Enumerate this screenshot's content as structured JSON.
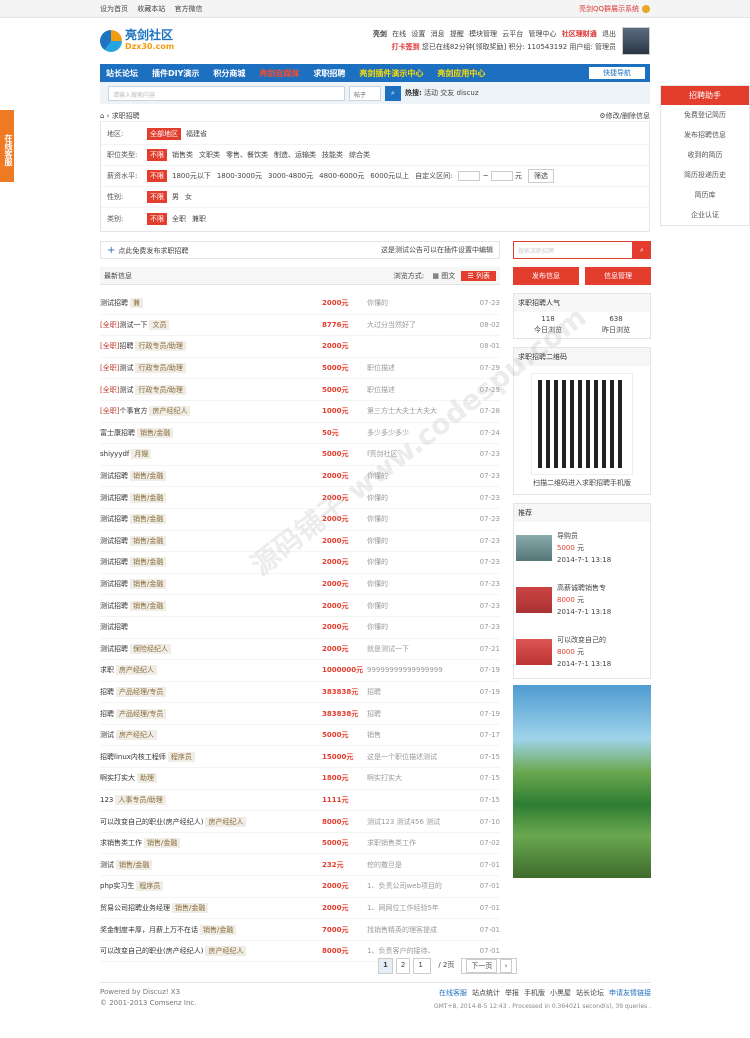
{
  "topbar": {
    "left": [
      "设为首页",
      "收藏本站",
      "官方微信"
    ],
    "right": "亮剑QQ群展示系统"
  },
  "logo": {
    "name": "亮剑社区",
    "domain": "Dzx30.com"
  },
  "user": {
    "name": "亮剑",
    "links": [
      "在线",
      "设置",
      "消息",
      "提醒",
      "模块管理",
      "云平台",
      "管理中心",
      "社区理财通",
      "退出"
    ],
    "line2": [
      "打卡签到",
      "您已在线82分钟[领取奖励]",
      "积分: 110543192",
      "用户组: 管理员"
    ]
  },
  "nav": {
    "items": [
      "站长论坛",
      "插件DIY演示",
      "积分商城",
      "亮剑自媒体",
      "求职招聘",
      "亮剑插件演示中心",
      "亮剑应用中心"
    ],
    "quick": "快捷导航"
  },
  "search": {
    "placeholder": "请输入搜索内容",
    "type": "帖子",
    "hot_label": "热搜:",
    "hot": [
      "活动",
      "交友",
      "discuz"
    ]
  },
  "breadcrumb": {
    "current": "求职招聘",
    "edit": "修改/删除信息"
  },
  "filters": {
    "area": {
      "label": "地区:",
      "selected": "全部地区",
      "options": [
        "福建省"
      ]
    },
    "job": {
      "label": "职位类型:",
      "selected": "不限",
      "options": [
        "销售类",
        "文职类",
        "零售、餐饮类",
        "制造、运输类",
        "技能类",
        "综合类"
      ]
    },
    "salary": {
      "label": "薪资水平:",
      "selected": "不限",
      "options": [
        "1800元以下",
        "1800-3000元",
        "3000-4800元",
        "4800-6000元",
        "6000元以上"
      ],
      "custom": "自定义区间:",
      "unit": "元",
      "btn": "筛选"
    },
    "gender": {
      "label": "性别:",
      "selected": "不限",
      "options": [
        "男",
        "女"
      ]
    },
    "kind": {
      "label": "类别:",
      "selected": "不限",
      "options": [
        "全职",
        "兼职"
      ]
    }
  },
  "post_bar": {
    "left": "点此免费发布求职招聘",
    "right": "这是测试公告可以在插件设置中编辑"
  },
  "list_head": {
    "title": "最新信息",
    "view": "浏览方式:",
    "pic": "图文",
    "list": "列表"
  },
  "rows": [
    {
      "pre": "",
      "title": "测试招聘",
      "cat": "兼",
      "salary": "2000元",
      "desc": "你懂的",
      "date": "07-23"
    },
    {
      "pre": "[全职]",
      "title": "测试一下",
      "cat": "文员",
      "salary": "8776元",
      "desc": "大过分当然好了",
      "date": "08-02"
    },
    {
      "pre": "[全职]",
      "title": "招聘",
      "cat": "行政专员/助理",
      "salary": "2000元",
      "desc": "",
      "date": "08-01"
    },
    {
      "pre": "[全职]",
      "title": "测试",
      "cat": "行政专员/助理",
      "salary": "5000元",
      "desc": "职位描述",
      "date": "07-29"
    },
    {
      "pre": "[全职]",
      "title": "测试",
      "cat": "行政专员/助理",
      "salary": "5000元",
      "desc": "职位描述",
      "date": "07-29"
    },
    {
      "pre": "[全职]",
      "title": "个事官方",
      "cat": "房产经纪人",
      "salary": "1000元",
      "desc": "第三方士大夫士大夫大",
      "date": "07-28"
    },
    {
      "pre": "",
      "title": "富士康招聘",
      "cat": "销售/金融",
      "salary": "50元",
      "desc": "多少多少多少",
      "date": "07-24"
    },
    {
      "pre": "",
      "title": "shiyyydf",
      "cat": "月嫂",
      "salary": "5000元",
      "desc": "f亮剑社区",
      "date": "07-23"
    },
    {
      "pre": "",
      "title": "测试招聘",
      "cat": "销售/金融",
      "salary": "2000元",
      "desc": "你懂的",
      "date": "07-23"
    },
    {
      "pre": "",
      "title": "测试招聘",
      "cat": "销售/金融",
      "salary": "2000元",
      "desc": "你懂的",
      "date": "07-23"
    },
    {
      "pre": "",
      "title": "测试招聘",
      "cat": "销售/金融",
      "salary": "2000元",
      "desc": "你懂的",
      "date": "07-23"
    },
    {
      "pre": "",
      "title": "测试招聘",
      "cat": "销售/金融",
      "salary": "2000元",
      "desc": "你懂的",
      "date": "07-23"
    },
    {
      "pre": "",
      "title": "测试招聘",
      "cat": "销售/金融",
      "salary": "2000元",
      "desc": "你懂的",
      "date": "07-23"
    },
    {
      "pre": "",
      "title": "测试招聘",
      "cat": "销售/金融",
      "salary": "2000元",
      "desc": "你懂的",
      "date": "07-23"
    },
    {
      "pre": "",
      "title": "测试招聘",
      "cat": "销售/金融",
      "salary": "2000元",
      "desc": "你懂的",
      "date": "07-23"
    },
    {
      "pre": "",
      "title": "测试招聘",
      "cat": "",
      "salary": "2000元",
      "desc": "你懂的",
      "date": "07-23"
    },
    {
      "pre": "",
      "title": "测试招聘",
      "cat": "保险经纪人",
      "salary": "2000元",
      "desc": "就是测试一下",
      "date": "07-21"
    },
    {
      "pre": "",
      "title": "求职",
      "cat": "房产经纪人",
      "salary": "1000000元",
      "desc": "99999999999999999",
      "date": "07-19"
    },
    {
      "pre": "",
      "title": "招聘",
      "cat": "产品经理/专员",
      "salary": "383838元",
      "desc": "招聘",
      "date": "07-19"
    },
    {
      "pre": "",
      "title": "招聘",
      "cat": "产品经理/专员",
      "salary": "383838元",
      "desc": "招聘",
      "date": "07-19"
    },
    {
      "pre": "",
      "title": "测试",
      "cat": "房产经纪人",
      "salary": "5000元",
      "desc": "销售",
      "date": "07-17"
    },
    {
      "pre": "",
      "title": "招聘linux内核工程师",
      "cat": "程序员",
      "salary": "15000元",
      "desc": "这是一个职位描述测试",
      "date": "07-15"
    },
    {
      "pre": "",
      "title": "啊实打实大",
      "cat": "助理",
      "salary": "1800元",
      "desc": "啊实打实大",
      "date": "07-15"
    },
    {
      "pre": "",
      "title": "123",
      "cat": "人事专员/助理",
      "salary": "1111元",
      "desc": "",
      "date": "07-15"
    },
    {
      "pre": "",
      "title": "可以改变自己的职业(房产经纪人)",
      "cat": "房产经纪人",
      "salary": "8000元",
      "desc": "测试123 测试456 测试",
      "date": "07-10"
    },
    {
      "pre": "",
      "title": "求销售类工作",
      "cat": "销售/金融",
      "salary": "5000元",
      "desc": "求职销售类工作",
      "date": "07-02"
    },
    {
      "pre": "",
      "title": "测试",
      "cat": "销售/金融",
      "salary": "232元",
      "desc": "挖的撒旦是",
      "date": "07-01"
    },
    {
      "pre": "",
      "title": "php实习生",
      "cat": "程序员",
      "salary": "2000元",
      "desc": "1、负责公司web项目的",
      "date": "07-01"
    },
    {
      "pre": "",
      "title": "贸易公司招聘业务经理",
      "cat": "销售/金融",
      "salary": "2000元",
      "desc": "1、网网位工作经验5年",
      "date": "07-01"
    },
    {
      "pre": "",
      "title": "奖金制度丰厚，月薪上万不在话",
      "cat": "销售/金融",
      "salary": "7000元",
      "desc": "找销售精英的理客提成",
      "date": "07-01"
    },
    {
      "pre": "",
      "title": "可以改变自己的职业(房产经纪人)",
      "cat": "房产经纪人",
      "salary": "8000元",
      "desc": "1、负责客户的接待、",
      "date": "07-01"
    }
  ],
  "pager": {
    "p1": "1",
    "p2": "2",
    "input": "1",
    "total": "/ 2页",
    "next": "下一页"
  },
  "side": {
    "search_ph": "搜索求职招聘",
    "btn_post": "发布信息",
    "btn_manage": "信息管理",
    "pop_title": "求职招聘人气",
    "today": "118",
    "today_l": "今日浏览",
    "yest": "638",
    "yest_l": "昨日浏览",
    "qr_title": "求职招聘二维码",
    "qr_text": "扫描二维码进入求职招聘手机版",
    "rec_title": "推荐",
    "recs": [
      {
        "t": "导购员",
        "p": "5000",
        "u": "元",
        "d": "2014-7-1 13:18"
      },
      {
        "t": "高薪诚聘销售专",
        "p": "8000",
        "u": "元",
        "d": "2014-7-1 13:18"
      },
      {
        "t": "可以改变自己的",
        "p": "8000",
        "u": "元",
        "d": "2014-7-1 13:18"
      }
    ]
  },
  "helper": {
    "title": "招聘助手",
    "items": [
      "免费登记简历",
      "发布招聘信息",
      "收到的简历",
      "简历投递历史",
      "简历库",
      "企业认证"
    ]
  },
  "kefu": "在线客服",
  "footer": {
    "powered": "Powered by Discuz! X3",
    "copy": "© 2001-2013 Comsenz Inc.",
    "links": [
      "在线客服",
      "站点统计",
      "举报",
      "手机版",
      "小黑屋",
      "站长论坛",
      "申请友情链接"
    ],
    "gmt": "GMT+8, 2014-8-5 12:43 , Processed in 0.364021 second(s), 39 queries ."
  },
  "watermark": "源码铺子 www.codespu.com"
}
